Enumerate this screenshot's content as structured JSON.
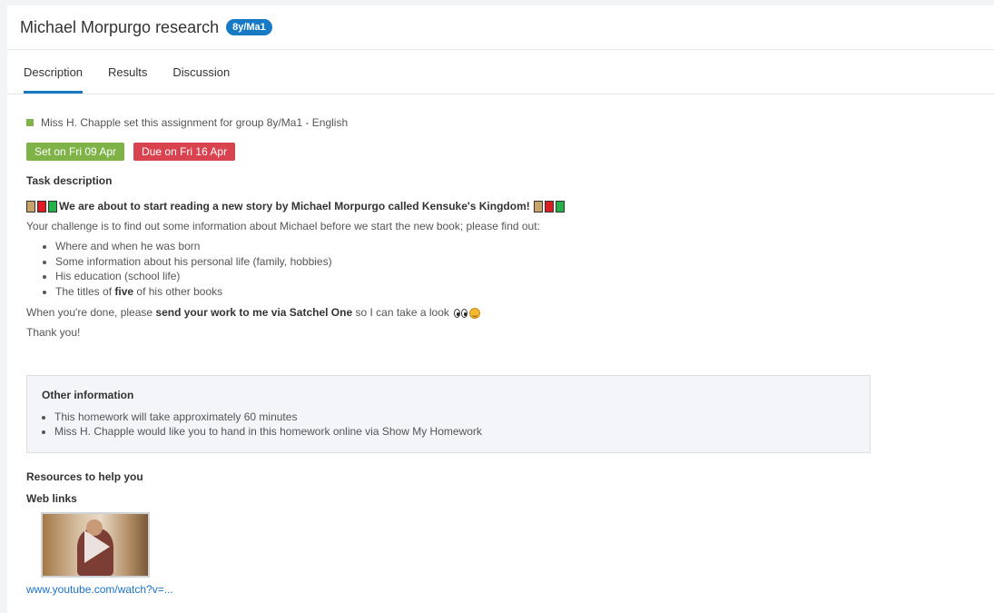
{
  "header": {
    "title": "Michael Morpurgo research",
    "group_badge": "8y/Ma1"
  },
  "tabs": [
    {
      "label": "Description",
      "active": true
    },
    {
      "label": "Results",
      "active": false
    },
    {
      "label": "Discussion",
      "active": false
    }
  ],
  "assignment": {
    "setter_text": "Miss H. Chapple set this assignment for group 8y/Ma1 - English",
    "set_date": "Set on Fri 09 Apr",
    "due_date": "Due on Fri 16 Apr"
  },
  "task": {
    "heading": "Task description",
    "headline": "We are about to start reading a new story by Michael Morpurgo called Kensuke's Kingdom!",
    "challenge": "Your challenge is to find out some information about Michael before we start the new book; please find out:",
    "items": [
      "Where and when he was born",
      "Some information about his personal life (family, hobbies)",
      "His education (school life)"
    ],
    "titles_prefix": "The titles of",
    "titles_bold": "five",
    "titles_suffix": "of his other books",
    "done_prefix": "When you're done, please",
    "done_bold": "send your work to me via Satchel One",
    "done_suffix": "so I can take a look",
    "thanks": "Thank you!"
  },
  "other_info": {
    "heading": "Other information",
    "items": [
      "This homework will take approximately 60 minutes",
      "Miss H. Chapple would like you to hand in this homework online via Show My Homework"
    ]
  },
  "resources": {
    "heading": "Resources to help you",
    "weblinks_heading": "Web links",
    "link_text": "www.youtube.com/watch?v=..."
  },
  "colors": {
    "accent": "#1879c4",
    "set_badge": "#7fb347",
    "due_badge": "#d9434f"
  }
}
